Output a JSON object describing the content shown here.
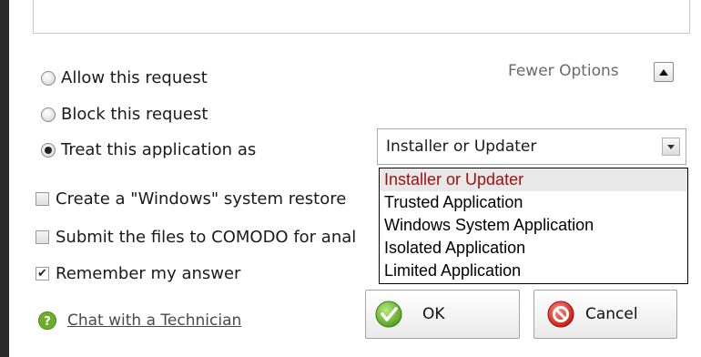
{
  "options": {
    "allow_label": "Allow this request",
    "block_label": "Block this request",
    "treat_label": "Treat this application as",
    "selected": "treat"
  },
  "fewer_options": {
    "label": "Fewer Options"
  },
  "select": {
    "value": "Installer or Updater",
    "options": [
      "Installer or Updater",
      "Trusted Application",
      "Windows System Application",
      "Isolated Application",
      "Limited Application"
    ]
  },
  "checkboxes": {
    "restore_label": "Create a \"Windows\" system restore",
    "submit_label": "Submit the files to COMODO for anal",
    "remember_label": "Remember my answer",
    "remember_checked": true
  },
  "help": {
    "link_label": "Chat with a Technician"
  },
  "buttons": {
    "ok_label": "OK",
    "cancel_label": "Cancel"
  },
  "colors": {
    "selected_option_text": "#a30f0f"
  }
}
